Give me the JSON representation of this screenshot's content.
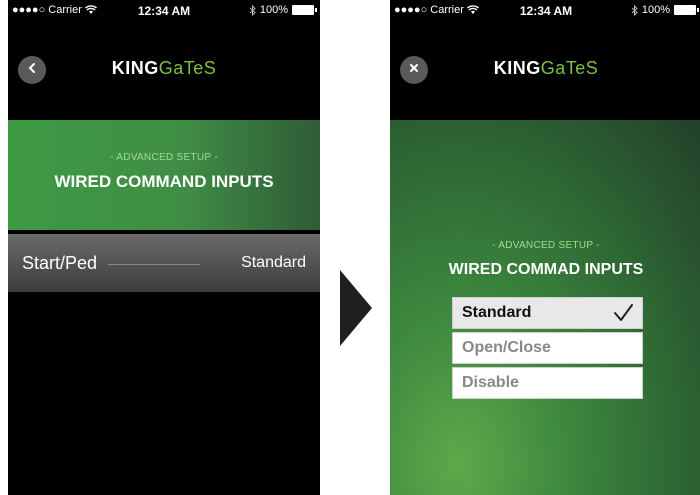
{
  "left_screen": {
    "status_bar": {
      "carrier": "●●●●○ Carrier",
      "time": "12:34 AM",
      "battery": "100%"
    },
    "header": {
      "back_icon": "chevron-left-icon",
      "logo_bold": "KING",
      "logo_light": "GaTeS"
    },
    "banner": {
      "subtitle": "- ADVANCED SETUP -",
      "title": "WIRED COMMAND INPUTS"
    },
    "setting": {
      "label": "Start/Ped",
      "value": "Standard"
    }
  },
  "right_screen": {
    "status_bar": {
      "carrier": "●●●●○ Carrier",
      "time": "12:34 AM",
      "battery": "100%"
    },
    "header": {
      "close_icon": "close-icon",
      "logo_bold": "KING",
      "logo_light": "GaTeS"
    },
    "subtitle": "- ADVANCED SETUP -",
    "title": "WIRED COMMAD INPUTS",
    "options": [
      {
        "label": "Standard",
        "selected": true
      },
      {
        "label": "Open/Close",
        "selected": false
      },
      {
        "label": "Disable",
        "selected": false
      }
    ]
  },
  "colors": {
    "brand_green": "#7bc043",
    "banner_green": "#3e9a43"
  },
  "arrow_icon": "play-arrow-icon"
}
